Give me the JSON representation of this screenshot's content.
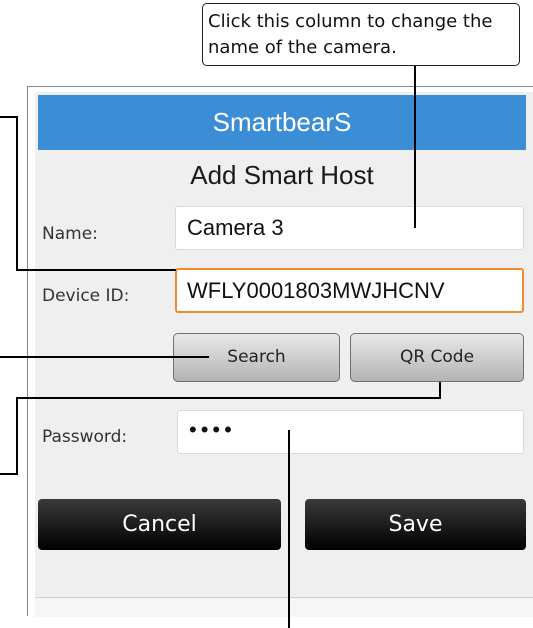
{
  "callout": {
    "line1": "Click this column to change the",
    "line2": "name of the camera."
  },
  "app": {
    "title": "SmartbearS"
  },
  "page": {
    "heading": "Add Smart Host"
  },
  "form": {
    "name_label": "Name:",
    "name_value": "Camera 3",
    "device_id_label": "Device ID:",
    "device_id_value": "WFLY0001803MWJHCNV",
    "password_label": "Password:",
    "password_value": "••••"
  },
  "buttons": {
    "search": "Search",
    "qr_code": "QR Code",
    "cancel": "Cancel",
    "save": "Save"
  },
  "colors": {
    "title_bar": "#3b8ed6",
    "active_field_border": "#f08c2c",
    "screen_background": "#efefef"
  }
}
